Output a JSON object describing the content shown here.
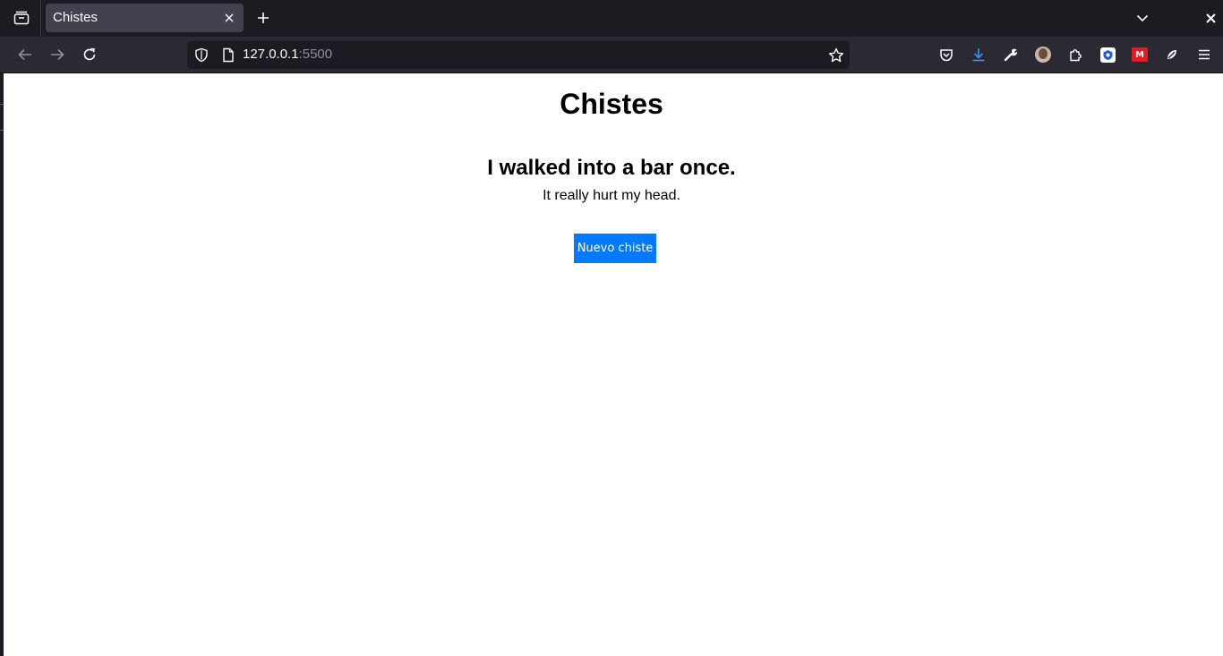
{
  "browser": {
    "tab": {
      "title": "Chistes"
    },
    "url": {
      "host": "127.0.0.1",
      "port": ":5500"
    },
    "icons": {
      "tab_list": "tab-list-icon",
      "tab_close": "close-icon",
      "new_tab": "plus-icon",
      "tabs_menu": "chevron-down-icon",
      "window_close": "close-icon",
      "back": "arrow-left-icon",
      "forward": "arrow-right-icon",
      "reload": "reload-icon",
      "shield": "shield-icon",
      "page": "page-icon",
      "bookmark": "star-icon",
      "pocket": "pocket-icon",
      "downloads": "download-icon",
      "devtools": "wrench-icon",
      "account": "avatar",
      "extensions": "puzzle-icon",
      "menu": "hamburger-menu-icon"
    },
    "accent_download": "#3f8fff"
  },
  "page": {
    "title": "Chistes",
    "joke": {
      "setup": "I walked into a bar once.",
      "punchline": "It really hurt my head."
    },
    "button_label": "Nuevo chiste",
    "button_color": "#007bff"
  }
}
